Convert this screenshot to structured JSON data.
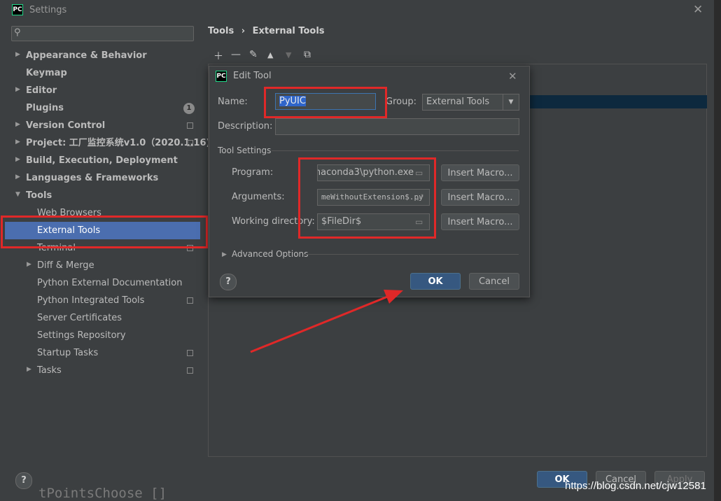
{
  "window": {
    "title": "Settings",
    "logo": "PC"
  },
  "search": {
    "placeholder": ""
  },
  "sidebar": {
    "items": [
      {
        "label": "Appearance & Behavior"
      },
      {
        "label": "Keymap"
      },
      {
        "label": "Editor"
      },
      {
        "label": "Plugins",
        "badge": "1"
      },
      {
        "label": "Version Control"
      },
      {
        "label": "Project: 工厂监控系统v1.0（2020.1.16)"
      },
      {
        "label": "Build, Execution, Deployment"
      },
      {
        "label": "Languages & Frameworks"
      },
      {
        "label": "Tools"
      },
      {
        "label": "Web Browsers"
      },
      {
        "label": "External Tools"
      },
      {
        "label": "Terminal"
      },
      {
        "label": "Diff & Merge"
      },
      {
        "label": "Python External Documentation"
      },
      {
        "label": "Python Integrated Tools"
      },
      {
        "label": "Server Certificates"
      },
      {
        "label": "Settings Repository"
      },
      {
        "label": "Startup Tasks"
      },
      {
        "label": "Tasks"
      }
    ]
  },
  "breadcrumb": {
    "parent": "Tools",
    "separator": "›",
    "current": "External Tools"
  },
  "toolbar": {
    "icons": [
      "plus-icon",
      "minus-icon",
      "pencil-icon",
      "arrow-up-icon",
      "arrow-down-icon",
      "copy-icon"
    ]
  },
  "dialog": {
    "title": "Edit Tool",
    "name_label": "Name:",
    "name_value": "PyUIC",
    "group_label": "Group:",
    "group_value": "External Tools",
    "description_label": "Description:",
    "description_value": "",
    "tool_settings_label": "Tool Settings",
    "program_label": "Program:",
    "program_value": "\\naconda3\\python.exe",
    "arguments_label": "Arguments:",
    "arguments_value": "meWithoutExtension$.py",
    "workdir_label": "Working directory:",
    "workdir_value": "$FileDir$",
    "insert_macro_label": "Insert Macro...",
    "advanced_label": "Advanced Options",
    "ok_label": "OK",
    "cancel_label": "Cancel",
    "help_label": "?"
  },
  "footer": {
    "help_label": "?",
    "ok_label": "OK",
    "cancel_label": "Cancel",
    "apply_label": "Apply"
  },
  "watermark": "https://blog.csdn.net/cjw12581",
  "behind_text": "tPointsChoose   []",
  "colors": {
    "selection": "#4b6eaf",
    "highlight_box": "#e02828",
    "primary_button": "#365880"
  }
}
